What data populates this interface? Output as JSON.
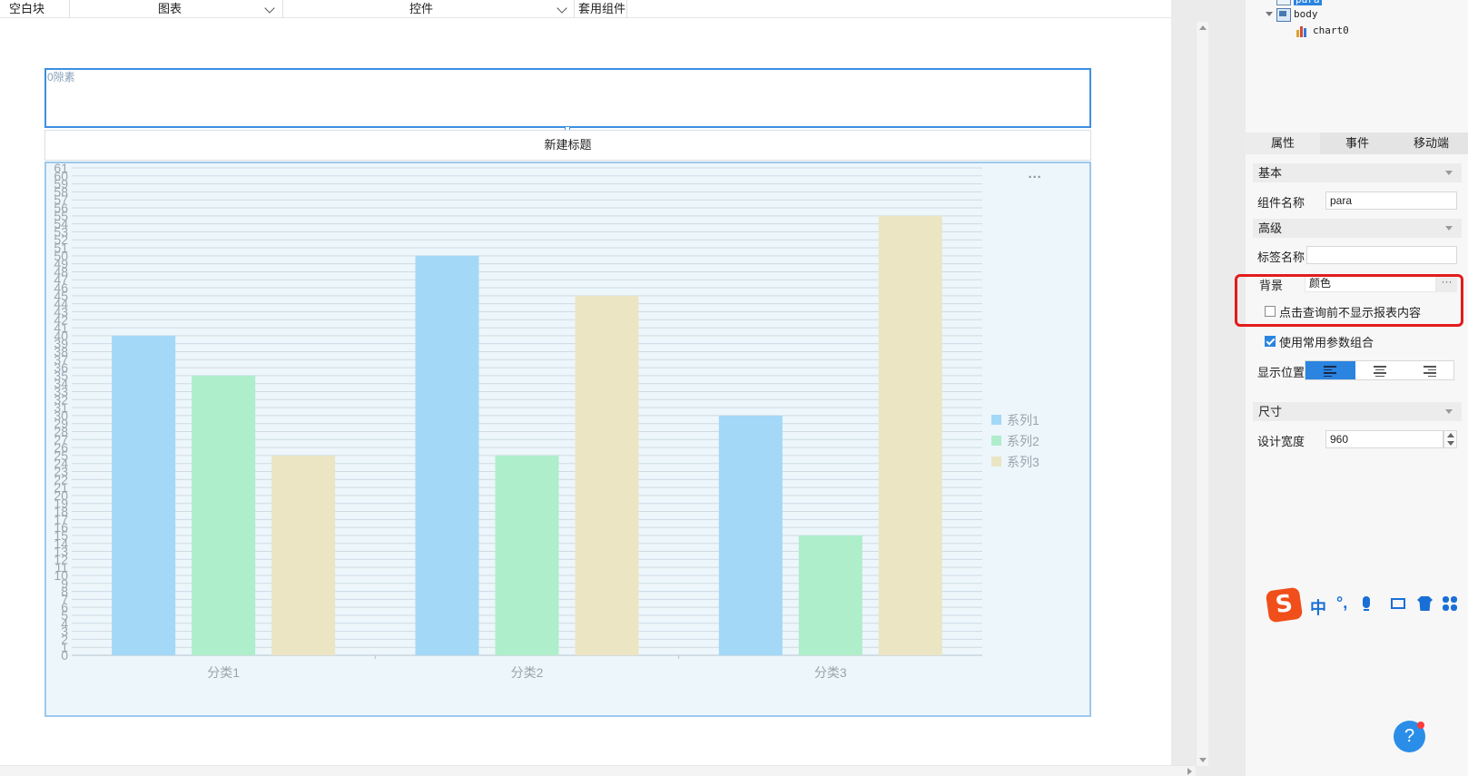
{
  "toolbar": {
    "blank_block": "空白块",
    "chart": "图表",
    "widget": "控件",
    "template_component": "套用组件"
  },
  "canvas": {
    "param_label": "0隙素",
    "chart_title": "新建标题",
    "more_label": "···"
  },
  "chart_data": {
    "type": "bar",
    "title": "新建标题",
    "categories": [
      "分类1",
      "分类2",
      "分类3"
    ],
    "series": [
      {
        "name": "系列1",
        "values": [
          40,
          50,
          30
        ],
        "color": "#a3d8f7"
      },
      {
        "name": "系列2",
        "values": [
          35,
          25,
          15
        ],
        "color": "#aeeecb"
      },
      {
        "name": "系列3",
        "values": [
          25,
          45,
          55
        ],
        "color": "#ebe5c3"
      }
    ],
    "ylim": [
      0,
      61
    ],
    "ytick_step": 1,
    "grid": true,
    "legend": "right"
  },
  "tree": {
    "para": "para",
    "body": "body",
    "chart0": "chart0"
  },
  "panel": {
    "tabs": [
      "属性",
      "事件",
      "移动端"
    ],
    "section_basic": "基本",
    "component_name_label": "组件名称",
    "component_name_value": "para",
    "section_advanced": "高级",
    "tag_name_label": "标签名称",
    "tag_name_value": "",
    "background_label": "背景",
    "background_value": "颜色",
    "background_more": "···",
    "hide_before_query_label": "点击查询前不显示报表内容",
    "hide_before_query_checked": false,
    "use_param_combo_label": "使用常用参数组合",
    "use_param_combo_checked": true,
    "display_position_label": "显示位置",
    "section_size": "尺寸",
    "design_width_label": "设计宽度",
    "design_width_value": "960"
  },
  "ime": {
    "zh": "中",
    "punct": "°,"
  },
  "help": "?",
  "colors": {
    "accent": "#2a84e0",
    "highlight": "#e31c1c"
  }
}
